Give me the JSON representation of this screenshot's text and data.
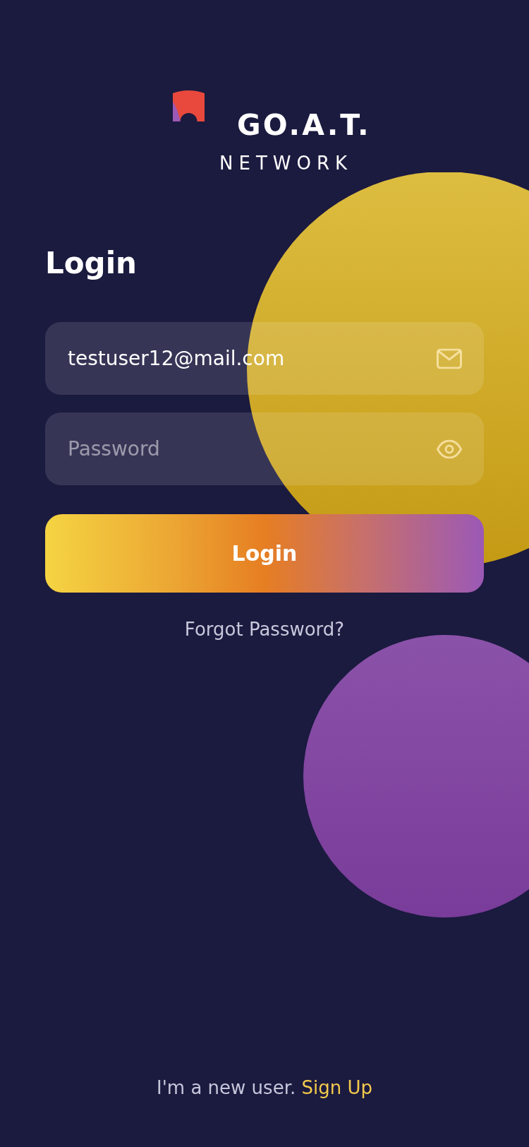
{
  "logo": {
    "title": "GO.A.T.",
    "subtitle": "NETWORK"
  },
  "heading": "Login",
  "fields": [
    {
      "kind": "email",
      "value": "testuser12@mail.com"
    },
    {
      "kind": "password",
      "placeholder": "Password"
    }
  ],
  "submit_button": "Login",
  "forgot_password_link": "Forgot Password?",
  "footer": {
    "text": "I'm a new user.",
    "link": "Sign Up"
  }
}
